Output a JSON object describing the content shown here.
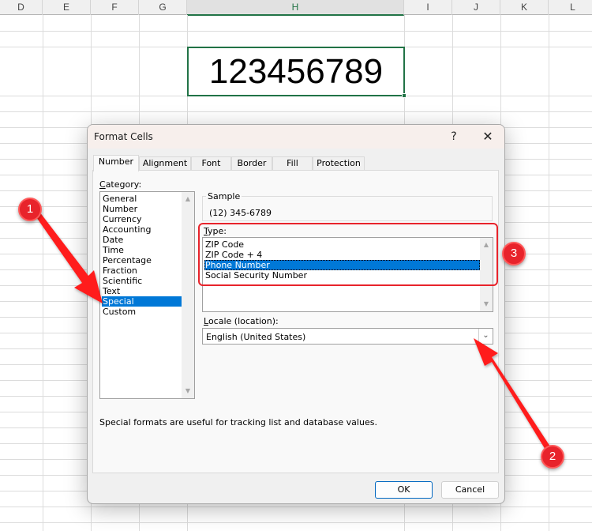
{
  "spreadsheet": {
    "columns": [
      "D",
      "E",
      "F",
      "G",
      "H",
      "I",
      "J",
      "K",
      "L"
    ],
    "selected_column": "H",
    "active_cell_value": "123456789",
    "selection_color": "#217346"
  },
  "dialog": {
    "title": "Format Cells",
    "help_label": "?",
    "close_label": "✕",
    "tabs": [
      {
        "label": "Number",
        "active": true
      },
      {
        "label": "Alignment",
        "active": false
      },
      {
        "label": "Font",
        "active": false
      },
      {
        "label": "Border",
        "active": false
      },
      {
        "label": "Fill",
        "active": false
      },
      {
        "label": "Protection",
        "active": false
      }
    ],
    "category": {
      "label_prefix": "C",
      "label_rest": "ategory:",
      "items": [
        "General",
        "Number",
        "Currency",
        "Accounting",
        "Date",
        "Time",
        "Percentage",
        "Fraction",
        "Scientific",
        "Text",
        "Special",
        "Custom"
      ],
      "selected": "Special"
    },
    "sample": {
      "label": "Sample",
      "value": "(12) 345-6789"
    },
    "type": {
      "label_prefix": "T",
      "label_rest": "ype:",
      "items": [
        "ZIP Code",
        "ZIP Code + 4",
        "Phone Number",
        "Social Security Number"
      ],
      "selected": "Phone Number"
    },
    "locale": {
      "label_prefix": "L",
      "label_rest": "ocale (location):",
      "value": "English (United States)"
    },
    "description": "Special formats are useful for tracking list and database values.",
    "ok_label": "OK",
    "cancel_label": "Cancel",
    "accent_color": "#0078d7"
  },
  "annotations": {
    "badges": [
      "1",
      "2",
      "3"
    ],
    "color": "#e8232b"
  }
}
